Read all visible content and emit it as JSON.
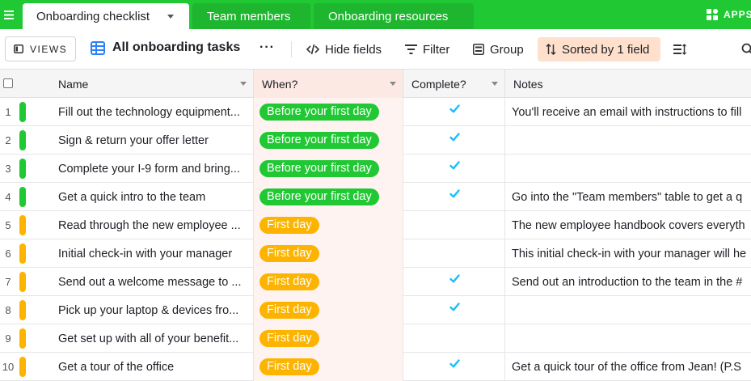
{
  "tabs": [
    {
      "label": "Onboarding checklist",
      "active": true
    },
    {
      "label": "Team members",
      "active": false
    },
    {
      "label": "Onboarding resources",
      "active": false
    }
  ],
  "apps_label": "APPS",
  "toolbar": {
    "views_label": "VIEWS",
    "view_name": "All onboarding tasks",
    "more_label": "···",
    "hide_fields": "Hide fields",
    "filter": "Filter",
    "group": "Group",
    "sorted": "Sorted by 1 field"
  },
  "columns": {
    "name": "Name",
    "when": "When?",
    "complete": "Complete?",
    "notes": "Notes"
  },
  "colors": {
    "topbar": "#20c933",
    "before_first_day": "#20c933",
    "first_day": "#fcb400",
    "check": "#18bfff",
    "sort_bg": "#ffe0cc"
  },
  "rows": [
    {
      "num": "1",
      "name": "Fill out the technology equipment...",
      "when": "Before your first day",
      "status": "before",
      "complete": true,
      "notes": "You'll receive an email with instructions to fill"
    },
    {
      "num": "2",
      "name": "Sign & return your offer letter",
      "when": "Before your first day",
      "status": "before",
      "complete": true,
      "notes": ""
    },
    {
      "num": "3",
      "name": "Complete your I-9 form and bring...",
      "when": "Before your first day",
      "status": "before",
      "complete": true,
      "notes": ""
    },
    {
      "num": "4",
      "name": "Get a quick intro to the team",
      "when": "Before your first day",
      "status": "before",
      "complete": true,
      "notes": "Go into the \"Team members\" table to get a q"
    },
    {
      "num": "5",
      "name": "Read through the new employee ...",
      "when": "First day",
      "status": "first",
      "complete": false,
      "notes": "The new employee handbook covers everyth"
    },
    {
      "num": "6",
      "name": "Initial check-in with your manager",
      "when": "First day",
      "status": "first",
      "complete": false,
      "notes": "This initial check-in with your manager will he"
    },
    {
      "num": "7",
      "name": "Send out a welcome message to ...",
      "when": "First day",
      "status": "first",
      "complete": true,
      "notes": "Send out an introduction to the team in the #"
    },
    {
      "num": "8",
      "name": "Pick up your laptop & devices fro...",
      "when": "First day",
      "status": "first",
      "complete": true,
      "notes": ""
    },
    {
      "num": "9",
      "name": "Get set up with all of your benefit...",
      "when": "First day",
      "status": "first",
      "complete": false,
      "notes": ""
    },
    {
      "num": "10",
      "name": "Get a tour of the office",
      "when": "First day",
      "status": "first",
      "complete": true,
      "notes": "Get a quick tour of the office from Jean! (P.S"
    }
  ]
}
